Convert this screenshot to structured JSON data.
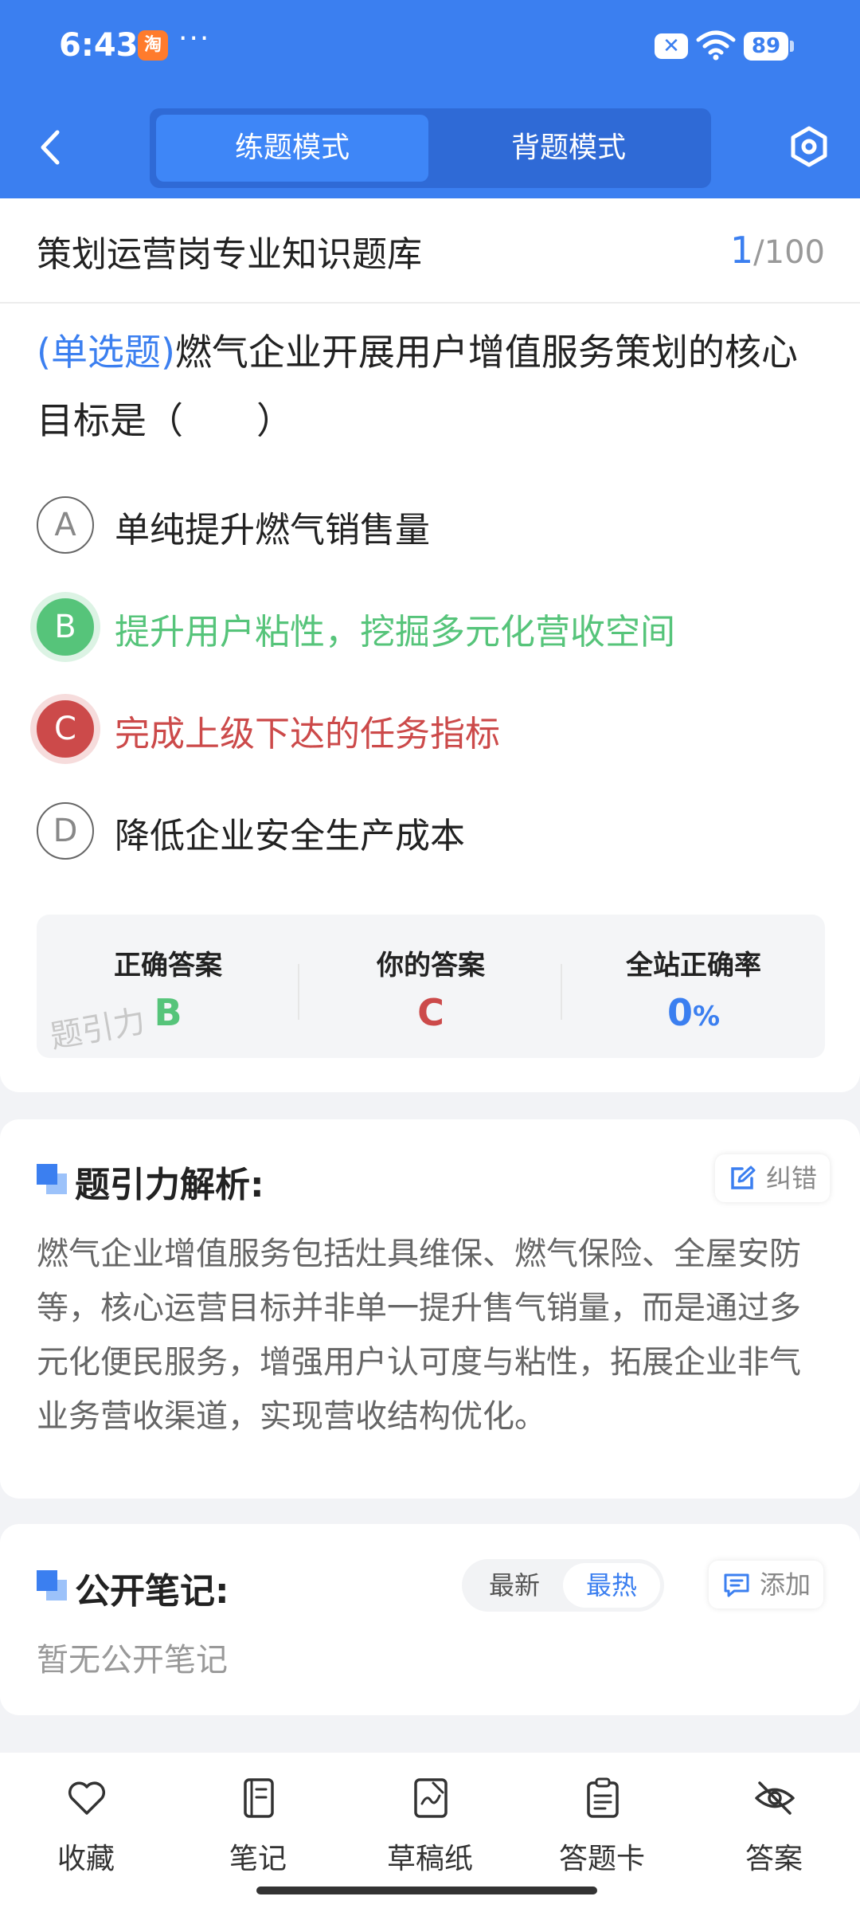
{
  "status_bar": {
    "time": "6:43",
    "app_icon_text": "淘",
    "more": "···",
    "battery": "89"
  },
  "header": {
    "modes": [
      "练题模式",
      "背题模式"
    ],
    "active_mode": "练题模式",
    "accent_color": "#3b7ff0"
  },
  "question_panel": {
    "bank_title": "策划运营岗专业知识题库",
    "progress_current": "1",
    "progress_total": "/100",
    "question_type": "(单选题)",
    "question_text": "燃气企业开展用户增值服务策划的核心目标是（　　）",
    "options": [
      {
        "letter": "A",
        "text": "单纯提升燃气销售量",
        "state": "normal"
      },
      {
        "letter": "B",
        "text": "提升用户粘性，挖掘多元化营收空间",
        "state": "correct"
      },
      {
        "letter": "C",
        "text": "完成上级下达的任务指标",
        "state": "wrong"
      },
      {
        "letter": "D",
        "text": "降低企业安全生产成本",
        "state": "normal"
      }
    ],
    "answer_stats": {
      "correct_label": "正确答案",
      "correct_value": "B",
      "yours_label": "你的答案",
      "yours_value": "C",
      "rate_label": "全站正确率",
      "rate_value": "0",
      "rate_unit": "%"
    },
    "watermark": "题引力"
  },
  "analysis": {
    "title": "题引力解析:",
    "report_label": "纠错",
    "text": "燃气企业增值服务包括灶具维保、燃气保险、全屋安防等，核心运营目标并非单一提升售气销量，而是通过多元化便民服务，增强用户认可度与粘性，拓展企业非气业务营收渠道，实现营收结构优化。"
  },
  "notes": {
    "title": "公开笔记:",
    "sort_options": [
      "最新",
      "最热"
    ],
    "active_sort": "最热",
    "add_label": "添加",
    "empty_text": "暂无公开笔记"
  },
  "bottom_nav": [
    {
      "label": "收藏",
      "icon": "heart-icon"
    },
    {
      "label": "笔记",
      "icon": "notebook-icon"
    },
    {
      "label": "草稿纸",
      "icon": "draft-paper-icon"
    },
    {
      "label": "答题卡",
      "icon": "answer-card-icon"
    },
    {
      "label": "答案",
      "icon": "eye-off-icon"
    }
  ],
  "colors": {
    "correct": "#56c47a",
    "wrong": "#cc4a4a"
  }
}
